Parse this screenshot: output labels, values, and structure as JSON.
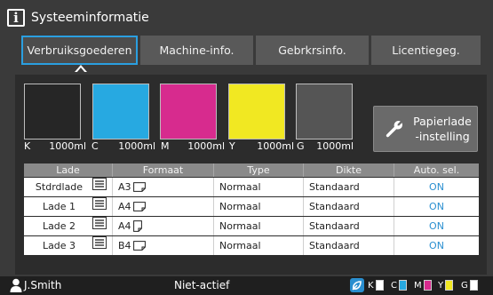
{
  "window": {
    "title": "Systeeminformatie"
  },
  "tabs": [
    {
      "label": "Verbruiksgoederen",
      "active": true
    },
    {
      "label": "Machine-info.",
      "active": false
    },
    {
      "label": "Gebrkrsinfo.",
      "active": false
    },
    {
      "label": "Licentiegeg.",
      "active": false
    }
  ],
  "inks": [
    {
      "code": "K",
      "amount": "1000ml",
      "color": "#262626"
    },
    {
      "code": "C",
      "amount": "1000ml",
      "color": "#27a9e1"
    },
    {
      "code": "M",
      "amount": "1000ml",
      "color": "#d72b8e"
    },
    {
      "code": "Y",
      "amount": "1000ml",
      "color": "#f1e822"
    },
    {
      "code": "G",
      "amount": "1000ml",
      "color": "#555555"
    }
  ],
  "tray_button": {
    "label_line1": "Papierlade",
    "label_line2": "-instelling",
    "icon": "wrench-icon"
  },
  "table": {
    "headers": [
      "Lade",
      "Formaat",
      "Type",
      "Dikte",
      "Auto. sel."
    ],
    "rows": [
      {
        "lade": "Stdrdlade",
        "formaat": "A3",
        "orientation": "landscape",
        "type": "Normaal",
        "dikte": "Standaard",
        "auto": "ON"
      },
      {
        "lade": "Lade 1",
        "formaat": "A4",
        "orientation": "landscape",
        "type": "Normaal",
        "dikte": "Standaard",
        "auto": "ON"
      },
      {
        "lade": "Lade 2",
        "formaat": "A4",
        "orientation": "portrait",
        "type": "Normaal",
        "dikte": "Standaard",
        "auto": "ON"
      },
      {
        "lade": "Lade 3",
        "formaat": "B4",
        "orientation": "landscape",
        "type": "Normaal",
        "dikte": "Standaard",
        "auto": "ON"
      }
    ]
  },
  "statusbar": {
    "user": "J.Smith",
    "status": "Niet-actief",
    "inks": [
      {
        "code": "K",
        "color": "#ffffff"
      },
      {
        "code": "C",
        "color": "#27a9e1"
      },
      {
        "code": "M",
        "color": "#d72b8e"
      },
      {
        "code": "Y",
        "color": "#f1e822"
      },
      {
        "code": "G",
        "color": "#ffffff"
      }
    ]
  },
  "colors": {
    "accent": "#2a9fe0",
    "on_text": "#2a8fd0"
  }
}
